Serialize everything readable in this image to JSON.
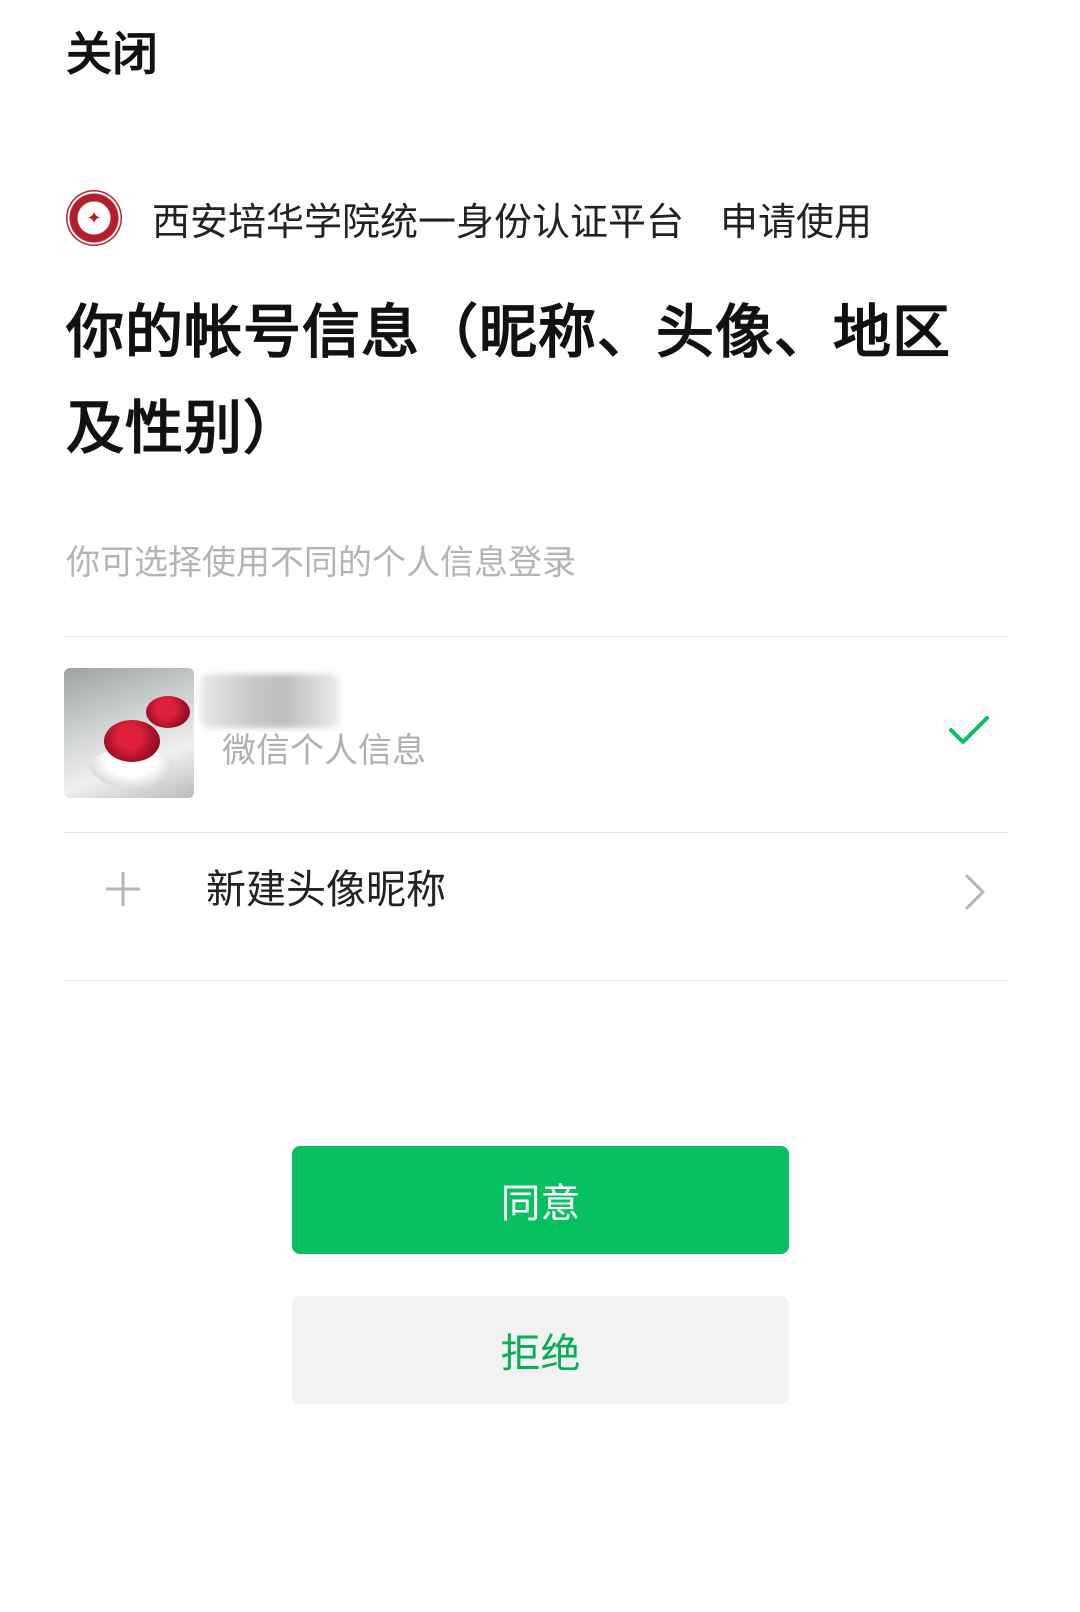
{
  "header": {
    "close_label": "关闭"
  },
  "app": {
    "name": "西安培华学院统一身份认证平台",
    "action": "申请使用",
    "logo_icon": "university-seal-icon"
  },
  "permission": {
    "title": "你的帐号信息（昵称、头像、地区及性别）",
    "subtitle": "你可选择使用不同的个人信息登录"
  },
  "profiles": [
    {
      "avatar_icon": "profile-avatar-image",
      "label": "微信个人信息",
      "selected": true
    }
  ],
  "new_profile": {
    "label": "新建头像昵称",
    "icon": "plus-icon"
  },
  "buttons": {
    "agree_label": "同意",
    "reject_label": "拒绝"
  },
  "colors": {
    "primary": "#07c160",
    "reject_text": "#06ae56",
    "reject_bg": "#f2f2f2",
    "muted_text": "#b4b4b4"
  }
}
